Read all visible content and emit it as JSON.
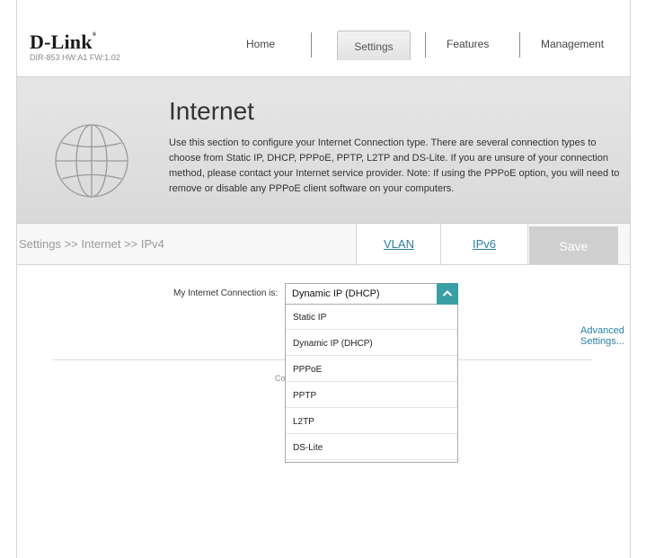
{
  "brand": {
    "logo": "D-Link",
    "model_info": "DIR-853 HW:A1 FW:1.02"
  },
  "nav": {
    "home": "Home",
    "settings": "Settings",
    "features": "Features",
    "management": "Management"
  },
  "banner": {
    "title": "Internet",
    "description": "Use this section to configure your Internet Connection type. There are several connection types to choose from Static IP, DHCP, PPPoE, PPTP, L2TP and DS-Lite. If you are unsure of your connection method, please contact your Internet service provider. Note: If using the PPPoE option, you will need to remove or disable any PPPoE client software on your computers."
  },
  "subbar": {
    "breadcrumb": "Settings >> Internet >> IPv4",
    "vlan": "VLAN",
    "ipv6": "IPv6",
    "save": "Save"
  },
  "connection": {
    "label": "My Internet Connection is:",
    "selected": "Dynamic IP (DHCP)",
    "options": [
      "Static IP",
      "Dynamic IP (DHCP)",
      "PPPoE",
      "PPTP",
      "L2TP",
      "DS-Lite"
    ],
    "advanced": "Advanced Settings...",
    "behind_text": "Co"
  },
  "colors": {
    "accent": "#3a9ea5",
    "link": "#2a7fa6",
    "save_disabled": "#cfcfcf"
  }
}
